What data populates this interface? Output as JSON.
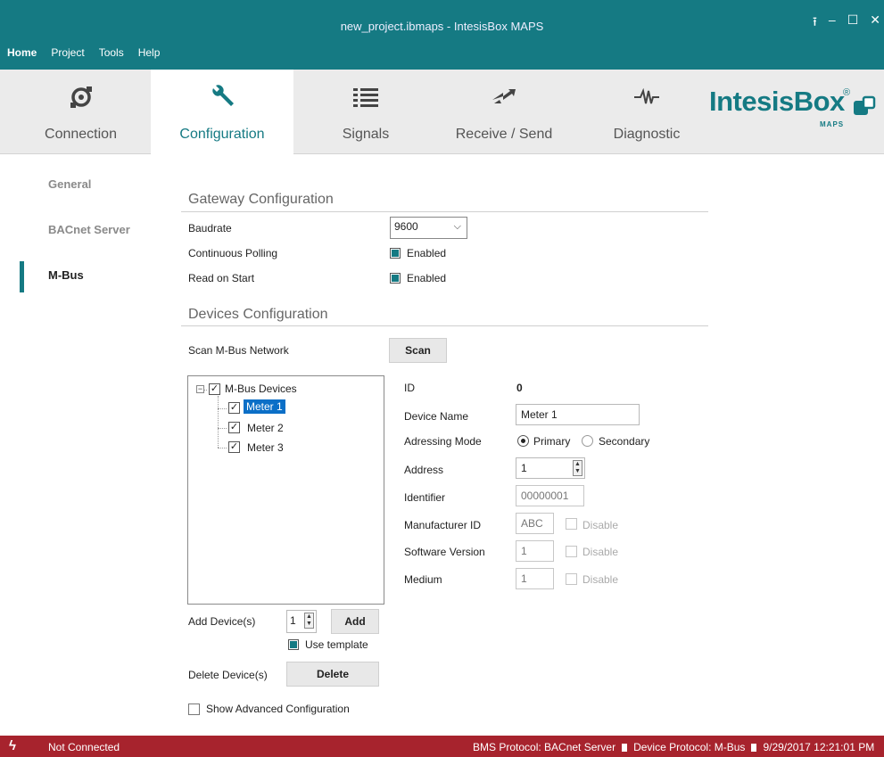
{
  "window": {
    "title": "new_project.ibmaps - IntesisBox MAPS",
    "controls": {
      "upload": "⭱",
      "minimize": "–",
      "maximize": "☐",
      "close": "✕"
    }
  },
  "menu": {
    "home": "Home",
    "project": "Project",
    "tools": "Tools",
    "help": "Help"
  },
  "ribbon": {
    "tabs": [
      {
        "label": "Connection",
        "icon": "connection-icon"
      },
      {
        "label": "Configuration",
        "icon": "wrench-icon"
      },
      {
        "label": "Signals",
        "icon": "list-icon"
      },
      {
        "label": "Receive / Send",
        "icon": "transfer-icon"
      },
      {
        "label": "Diagnostic",
        "icon": "waveform-icon"
      }
    ],
    "brand": {
      "name": "IntesisBox",
      "reg": "®",
      "sub": "MAPS"
    }
  },
  "sidebar": {
    "items": [
      {
        "label": "General"
      },
      {
        "label": "BACnet Server"
      },
      {
        "label": "M-Bus"
      }
    ]
  },
  "gateway": {
    "title": "Gateway Configuration",
    "baudrate_label": "Baudrate",
    "baudrate_value": "9600",
    "polling_label": "Continuous Polling",
    "polling_value": "Enabled",
    "read_label": "Read on Start",
    "read_value": "Enabled"
  },
  "devices": {
    "title": "Devices Configuration",
    "scan_label": "Scan M-Bus Network",
    "scan_button": "Scan",
    "tree": {
      "root": "M-Bus Devices",
      "items": [
        "Meter 1",
        "Meter 2",
        "Meter 3"
      ]
    },
    "add_label": "Add Device(s)",
    "add_count": "1",
    "add_button": "Add",
    "use_template": "Use template",
    "delete_label": "Delete Device(s)",
    "delete_button": "Delete",
    "advanced": "Show Advanced Configuration"
  },
  "detail": {
    "id_label": "ID",
    "id_value": "0",
    "name_label": "Device Name",
    "name_value": "Meter 1",
    "mode_label": "Adressing Mode",
    "mode_primary": "Primary",
    "mode_secondary": "Secondary",
    "address_label": "Address",
    "address_value": "1",
    "identifier_label": "Identifier",
    "identifier_value": "00000001",
    "manufacturer_label": "Manufacturer ID",
    "manufacturer_value": "ABC",
    "software_label": "Software Version",
    "software_value": "1",
    "medium_label": "Medium",
    "medium_value": "1",
    "disable": "Disable"
  },
  "status": {
    "connection": "Not Connected",
    "bms": "BMS Protocol: BACnet Server",
    "device": "Device Protocol: M-Bus",
    "datetime": "9/29/2017 12:21:01 PM"
  },
  "colors": {
    "accent": "#157a83",
    "status_bg": "#a7232d",
    "selection": "#0b6fc7"
  }
}
